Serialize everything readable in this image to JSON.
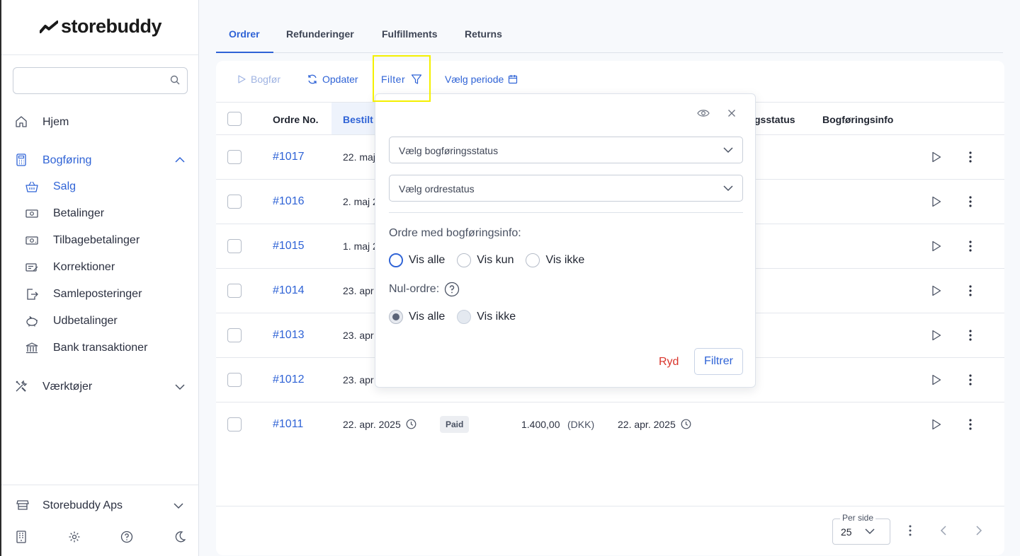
{
  "app": {
    "brand": "storebuddy"
  },
  "sidebar": {
    "search": {
      "placeholder": "",
      "icon": "search-icon"
    },
    "items": [
      {
        "label": "Hjem",
        "icon": "home-icon"
      },
      {
        "label": "Bogføring",
        "icon": "calculator-icon",
        "expanded": true
      },
      {
        "label": "Værktøjer",
        "icon": "tools-icon",
        "expanded": false
      }
    ],
    "sub_items": [
      {
        "label": "Salg",
        "icon": "basket-icon",
        "active": true
      },
      {
        "label": "Betalinger",
        "icon": "cash-icon"
      },
      {
        "label": "Tilbagebetalinger",
        "icon": "refund-icon"
      },
      {
        "label": "Korrektioner",
        "icon": "edit-note-icon"
      },
      {
        "label": "Samleposteringer",
        "icon": "export-icon"
      },
      {
        "label": "Udbetalinger",
        "icon": "piggy-bank-icon"
      },
      {
        "label": "Bank transaktioner",
        "icon": "bank-icon"
      }
    ],
    "bottom": {
      "apps_label": "Storebuddy Aps",
      "icons": [
        "building-icon",
        "gear-icon",
        "help-icon",
        "moon-icon"
      ]
    }
  },
  "tabs": [
    {
      "label": "Ordrer",
      "active": true
    },
    {
      "label": "Refunderinger"
    },
    {
      "label": "Fulfillments"
    },
    {
      "label": "Returns"
    }
  ],
  "toolbar": {
    "post_label": "Bogfør",
    "refresh_label": "Opdater",
    "filter_label": "Filter",
    "period_label": "Vælg periode"
  },
  "table": {
    "columns": [
      "Ordre No.",
      "Bestilt",
      "gsstatus",
      "Bogføringsinfo"
    ],
    "rows": [
      {
        "order": "#1017",
        "date": "22. maj"
      },
      {
        "order": "#1016",
        "date": "2. maj 2"
      },
      {
        "order": "#1015",
        "date": "1. maj 2"
      },
      {
        "order": "#1014",
        "date": "23. apr"
      },
      {
        "order": "#1013",
        "date": "23. apr"
      },
      {
        "order": "#1012",
        "date": "23. apr"
      },
      {
        "order": "#1011",
        "date": "22. apr. 2025",
        "status": "Paid",
        "amount": "1.400,00",
        "currency": "(DKK)",
        "posted": "22. apr. 2025"
      }
    ]
  },
  "pagination": {
    "per_page_label": "Per side",
    "per_page_value": "25"
  },
  "filter_popup": {
    "posting_status_placeholder": "Vælg bogføringsstatus",
    "order_status_placeholder": "Vælg ordrestatus",
    "posting_info_label": "Ordre med bogføringsinfo:",
    "posting_info_options": [
      "Vis alle",
      "Vis kun",
      "Vis ikke"
    ],
    "zero_order_label": "Nul-ordre:",
    "zero_order_options": [
      "Vis alle",
      "Vis ikke"
    ],
    "clear_label": "Ryd",
    "apply_label": "Filtrer"
  },
  "colors": {
    "accent": "#2f63d6",
    "danger": "#d9342b",
    "highlight": "#f4f000"
  }
}
